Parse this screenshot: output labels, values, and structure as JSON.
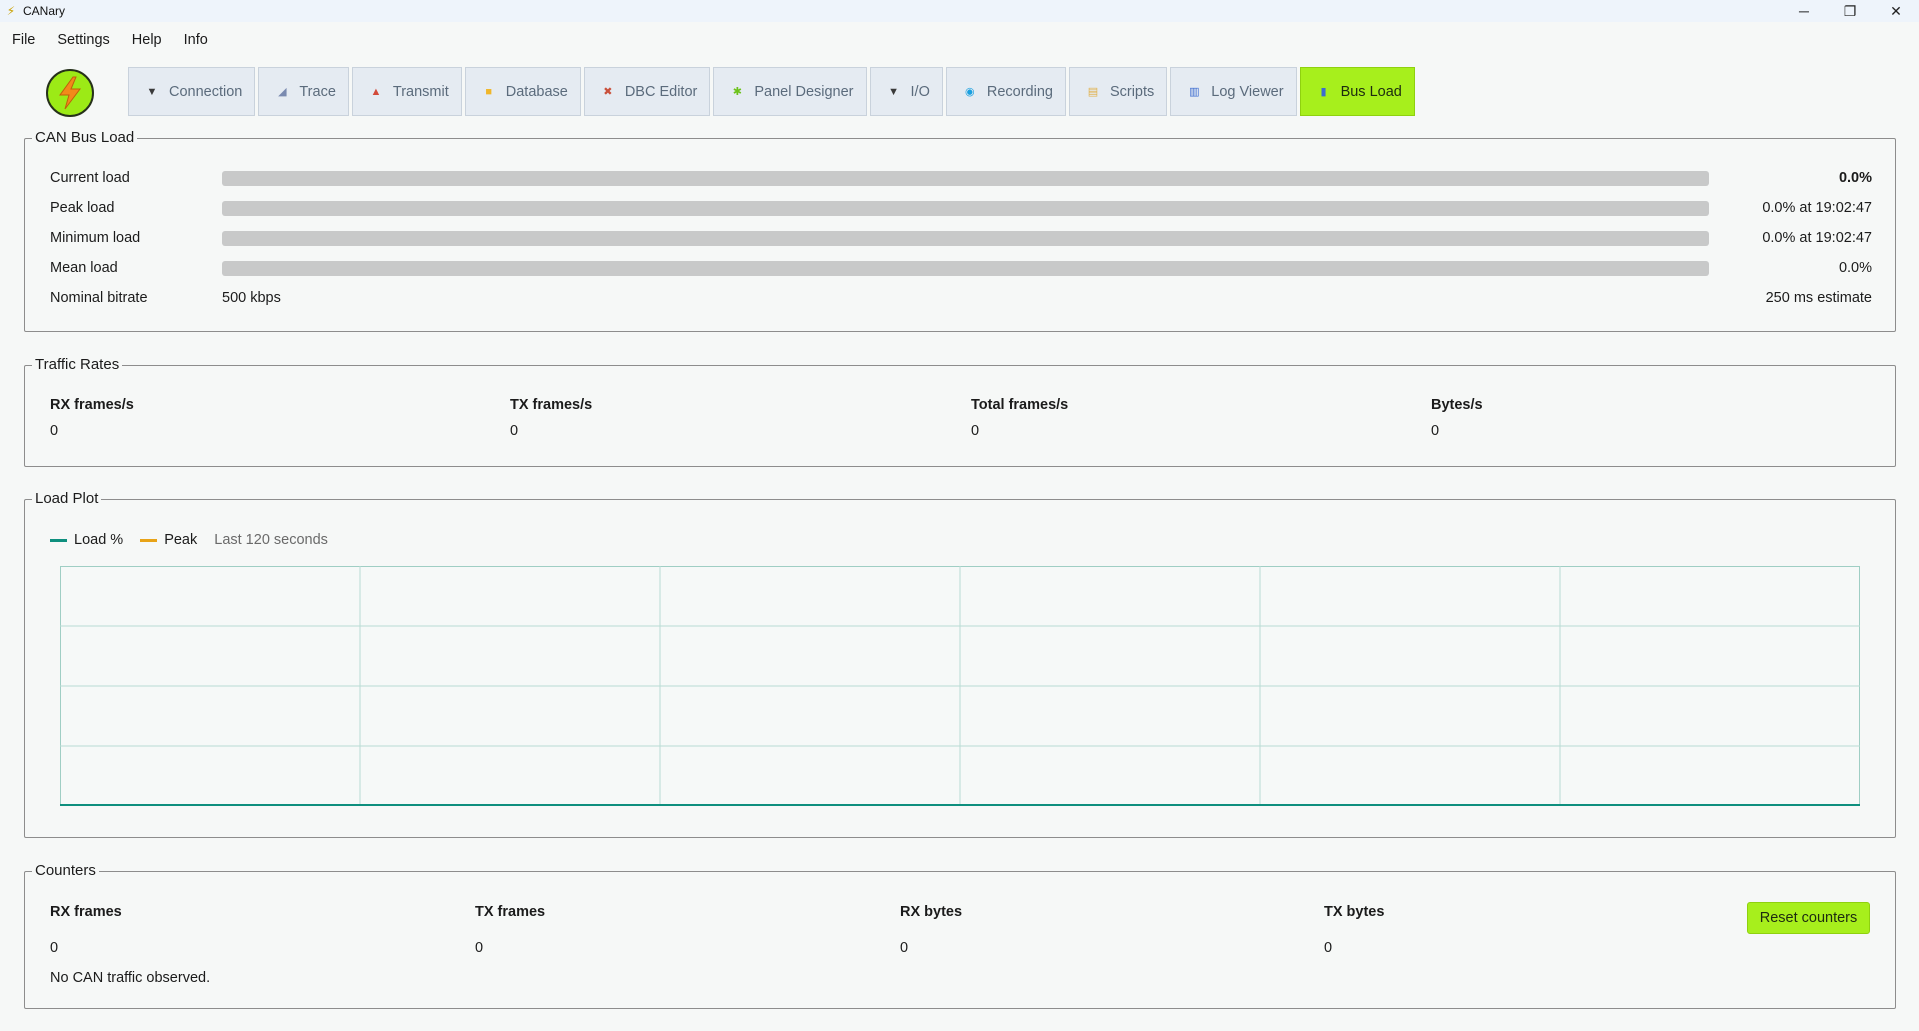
{
  "window": {
    "title": "CANary",
    "minimize": "─",
    "maximize": "❐",
    "close": "✕"
  },
  "menu": [
    "File",
    "Settings",
    "Help",
    "Info"
  ],
  "tabs": [
    {
      "label": "Connection",
      "icon": "plug-icon",
      "glyph": "▼",
      "color": "#3a3a3a"
    },
    {
      "label": "Trace",
      "icon": "chart-line-icon",
      "glyph": "◢",
      "color": "#7a8ab0"
    },
    {
      "label": "Transmit",
      "icon": "upload-icon",
      "glyph": "▲",
      "color": "#d24a3a"
    },
    {
      "label": "Database",
      "icon": "folder-icon",
      "glyph": "■",
      "color": "#f0b62a"
    },
    {
      "label": "DBC Editor",
      "icon": "tools-icon",
      "glyph": "✖",
      "color": "#c9503b"
    },
    {
      "label": "Panel Designer",
      "icon": "puzzle-icon",
      "glyph": "✱",
      "color": "#6cc21b"
    },
    {
      "label": "I/O",
      "icon": "plug-icon",
      "glyph": "▼",
      "color": "#3a3a3a"
    },
    {
      "label": "Recording",
      "icon": "record-icon",
      "glyph": "◉",
      "color": "#1aa0e0"
    },
    {
      "label": "Scripts",
      "icon": "scroll-icon",
      "glyph": "▤",
      "color": "#e1b04a"
    },
    {
      "label": "Log Viewer",
      "icon": "books-icon",
      "glyph": "▥",
      "color": "#3b6bd0"
    },
    {
      "label": "Bus Load",
      "icon": "bar-chart-icon",
      "glyph": "▮",
      "color": "#3b6bd0",
      "active": true
    }
  ],
  "busload": {
    "title": "CAN Bus Load",
    "rows": [
      {
        "label": "Current load",
        "value": "0.0%",
        "fill": 0.0,
        "bold": true
      },
      {
        "label": "Peak load",
        "value": "0.0% at 19:02:47",
        "fill": 0.0
      },
      {
        "label": "Minimum load",
        "value": "0.0% at 19:02:47",
        "fill": 0.0
      },
      {
        "label": "Mean load",
        "value": "0.0%",
        "fill": 0.0
      }
    ],
    "bitrate_label": "Nominal bitrate",
    "bitrate_value": "500 kbps",
    "estimate": "250 ms estimate"
  },
  "traffic": {
    "title": "Traffic Rates",
    "cols": [
      {
        "label": "RX frames/s",
        "value": "0"
      },
      {
        "label": "TX frames/s",
        "value": "0"
      },
      {
        "label": "Total frames/s",
        "value": "0"
      },
      {
        "label": "Bytes/s",
        "value": "0"
      }
    ]
  },
  "plot": {
    "title": "Load Plot",
    "legend_load": "Load %",
    "legend_peak": "Peak",
    "window_note": "Last 120 seconds",
    "load_color": "#0e8f7e",
    "peak_color": "#e8a317",
    "grid_color": "#b8dcd4"
  },
  "chart_data": {
    "type": "line",
    "series": [
      {
        "name": "Load %",
        "values": [
          0,
          0
        ]
      },
      {
        "name": "Peak",
        "values": []
      }
    ],
    "x": [
      0,
      120
    ],
    "xlim": [
      0,
      120
    ],
    "ylim": [
      0,
      100
    ],
    "grid": true,
    "legend": "top-left"
  },
  "counters": {
    "title": "Counters",
    "cols": [
      {
        "label": "RX frames",
        "value": "0"
      },
      {
        "label": "TX frames",
        "value": "0"
      },
      {
        "label": "RX bytes",
        "value": "0"
      },
      {
        "label": "TX bytes",
        "value": "0"
      }
    ],
    "reset_label": "Reset counters",
    "status": "No CAN traffic observed."
  },
  "colors": {
    "accent": "#a7ef1c",
    "bar_bg": "#c8c9c9",
    "load": "#0e8f7e"
  }
}
